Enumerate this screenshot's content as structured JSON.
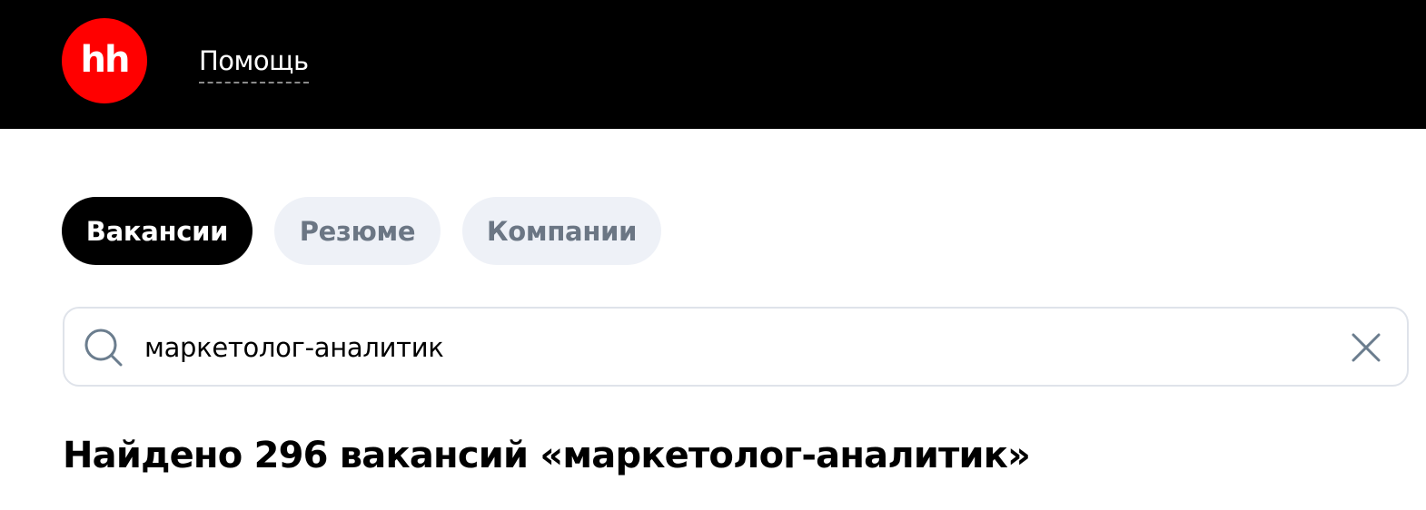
{
  "header": {
    "logo_text": "hh",
    "help_label": "Помощь",
    "background_color": "#000000",
    "logo_color": "#ff0000"
  },
  "tabs": [
    {
      "label": "Вакансии",
      "active": true
    },
    {
      "label": "Резюме",
      "active": false
    },
    {
      "label": "Компании",
      "active": false
    }
  ],
  "search": {
    "value": "маркетолог-аналитик",
    "search_icon": "search-icon",
    "clear_icon": "close-icon"
  },
  "results": {
    "heading": "Найдено 296 вакансий «маркетолог-аналитик»"
  }
}
